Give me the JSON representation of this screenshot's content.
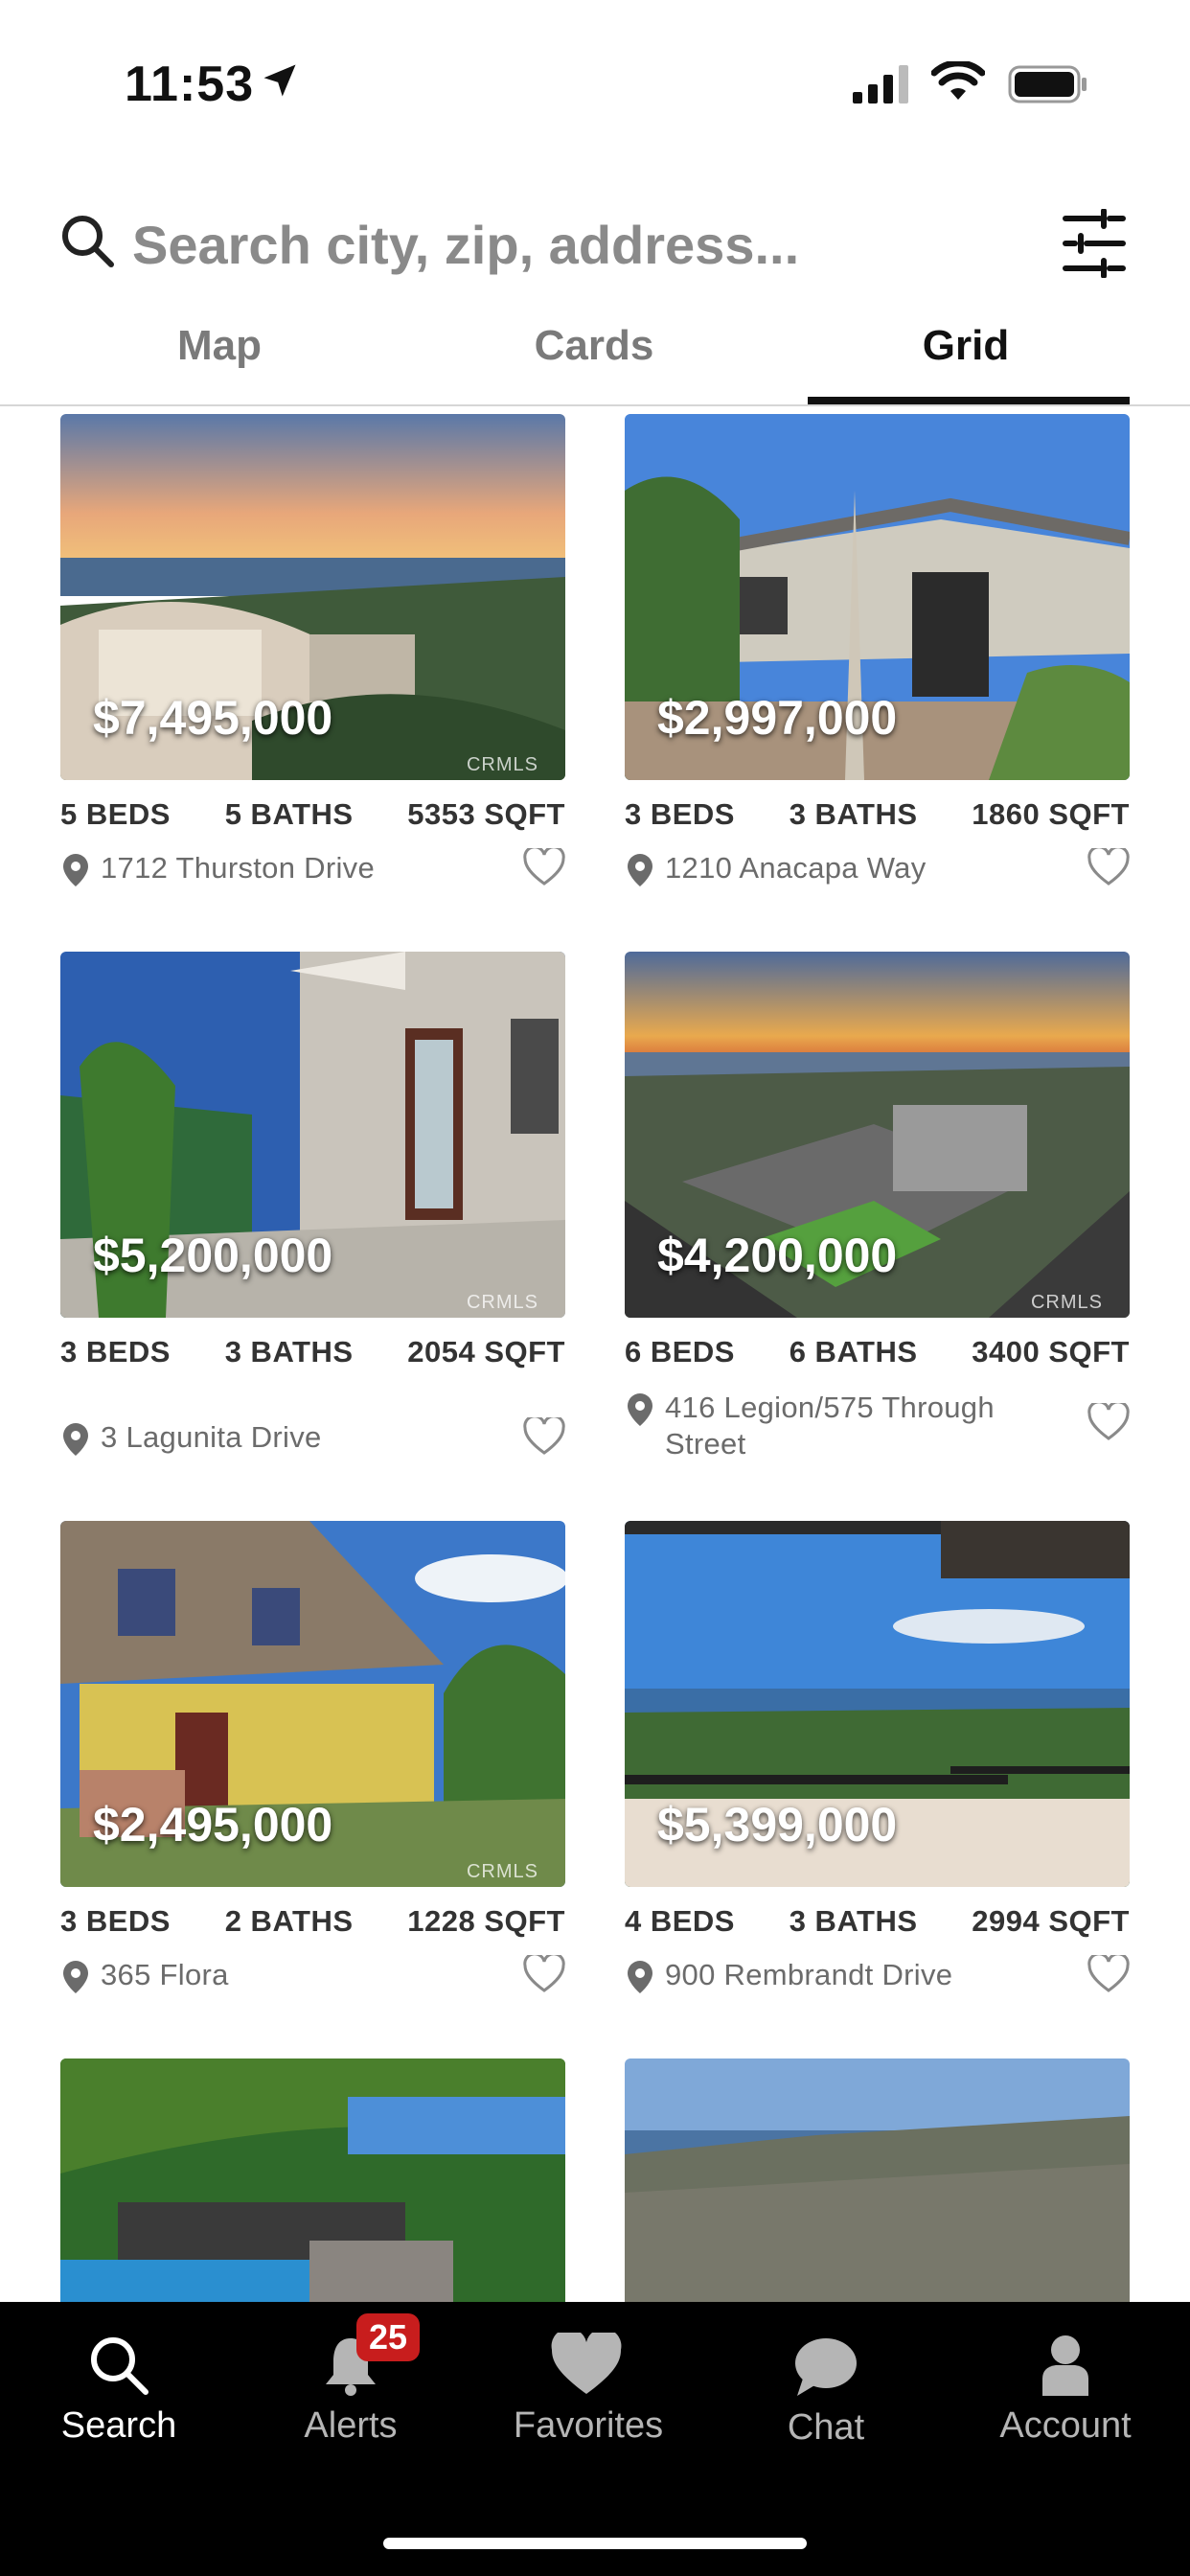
{
  "status_bar": {
    "time": "11:53"
  },
  "search": {
    "placeholder": "Search city, zip, address..."
  },
  "tabs": [
    {
      "label": "Map",
      "active": false
    },
    {
      "label": "Cards",
      "active": false
    },
    {
      "label": "Grid",
      "active": true
    }
  ],
  "listings": [
    {
      "price": "$7,495,000",
      "beds": "5 BEDS",
      "baths": "5 BATHS",
      "sqft": "5353 SQFT",
      "address": "1712 Thurston Drive",
      "watermark": "CRMLS"
    },
    {
      "price": "$2,997,000",
      "beds": "3 BEDS",
      "baths": "3 BATHS",
      "sqft": "1860 SQFT",
      "address": "1210 Anacapa Way",
      "watermark": ""
    },
    {
      "price": "$5,200,000",
      "beds": "3 BEDS",
      "baths": "3 BATHS",
      "sqft": "2054 SQFT",
      "address": "3 Lagunita Drive",
      "watermark": "CRMLS"
    },
    {
      "price": "$4,200,000",
      "beds": "6 BEDS",
      "baths": "6 BATHS",
      "sqft": "3400 SQFT",
      "address": "416 Legion/575 Through Street",
      "watermark": "CRMLS"
    },
    {
      "price": "$2,495,000",
      "beds": "3 BEDS",
      "baths": "2 BATHS",
      "sqft": "1228 SQFT",
      "address": "365 Flora",
      "watermark": "CRMLS"
    },
    {
      "price": "$5,399,000",
      "beds": "4 BEDS",
      "baths": "3 BATHS",
      "sqft": "2994 SQFT",
      "address": "900 Rembrandt Drive",
      "watermark": ""
    }
  ],
  "tabbar": {
    "items": [
      {
        "label": "Search",
        "icon": "search-icon",
        "active": true
      },
      {
        "label": "Alerts",
        "icon": "bell-icon",
        "active": false
      },
      {
        "label": "Favorites",
        "icon": "heart-icon",
        "active": false
      },
      {
        "label": "Chat",
        "icon": "chat-bubble-icon",
        "active": false
      },
      {
        "label": "Account",
        "icon": "person-icon",
        "active": false
      }
    ],
    "alerts_badge": "25"
  },
  "colors": {
    "badge": "#c81d1d",
    "tabbar_bg": "#000000",
    "active_tab": "#111111"
  }
}
